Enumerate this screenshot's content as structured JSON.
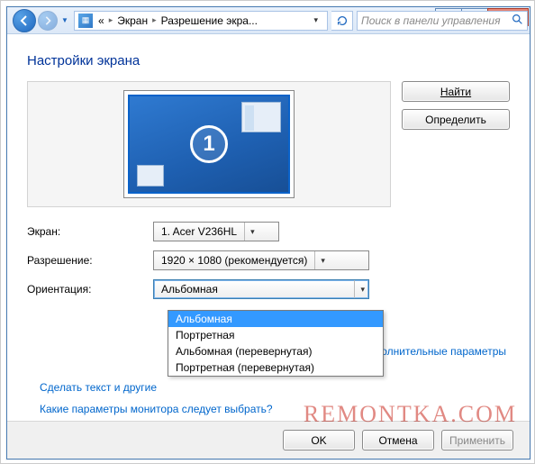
{
  "window": {
    "controls": {
      "min": "—",
      "max": "▢",
      "close": "✕"
    }
  },
  "breadcrumb": {
    "chevrons": "«",
    "item1": "Экран",
    "item2": "Разрешение экра..."
  },
  "search": {
    "placeholder": "Поиск в панели управления"
  },
  "heading": "Настройки экрана",
  "buttons": {
    "find": "Найти",
    "detect": "Определить",
    "ok": "OK",
    "cancel": "Отмена",
    "apply": "Применить"
  },
  "monitor_preview": {
    "number": "1"
  },
  "labels": {
    "display": "Экран:",
    "resolution": "Разрешение:",
    "orientation": "Ориентация:"
  },
  "values": {
    "display": "1. Acer V236HL",
    "resolution": "1920 × 1080 (рекомендуется)",
    "orientation": "Альбомная"
  },
  "orientation_options": [
    "Альбомная",
    "Портретная",
    "Альбомная (перевернутая)",
    "Портретная (перевернутая)"
  ],
  "links": {
    "advanced": "Дополнительные параметры",
    "text_size": "Сделать текст и другие",
    "which_monitor": "Какие параметры монитора следует выбрать?"
  },
  "watermark": "REMONTKA.COM"
}
